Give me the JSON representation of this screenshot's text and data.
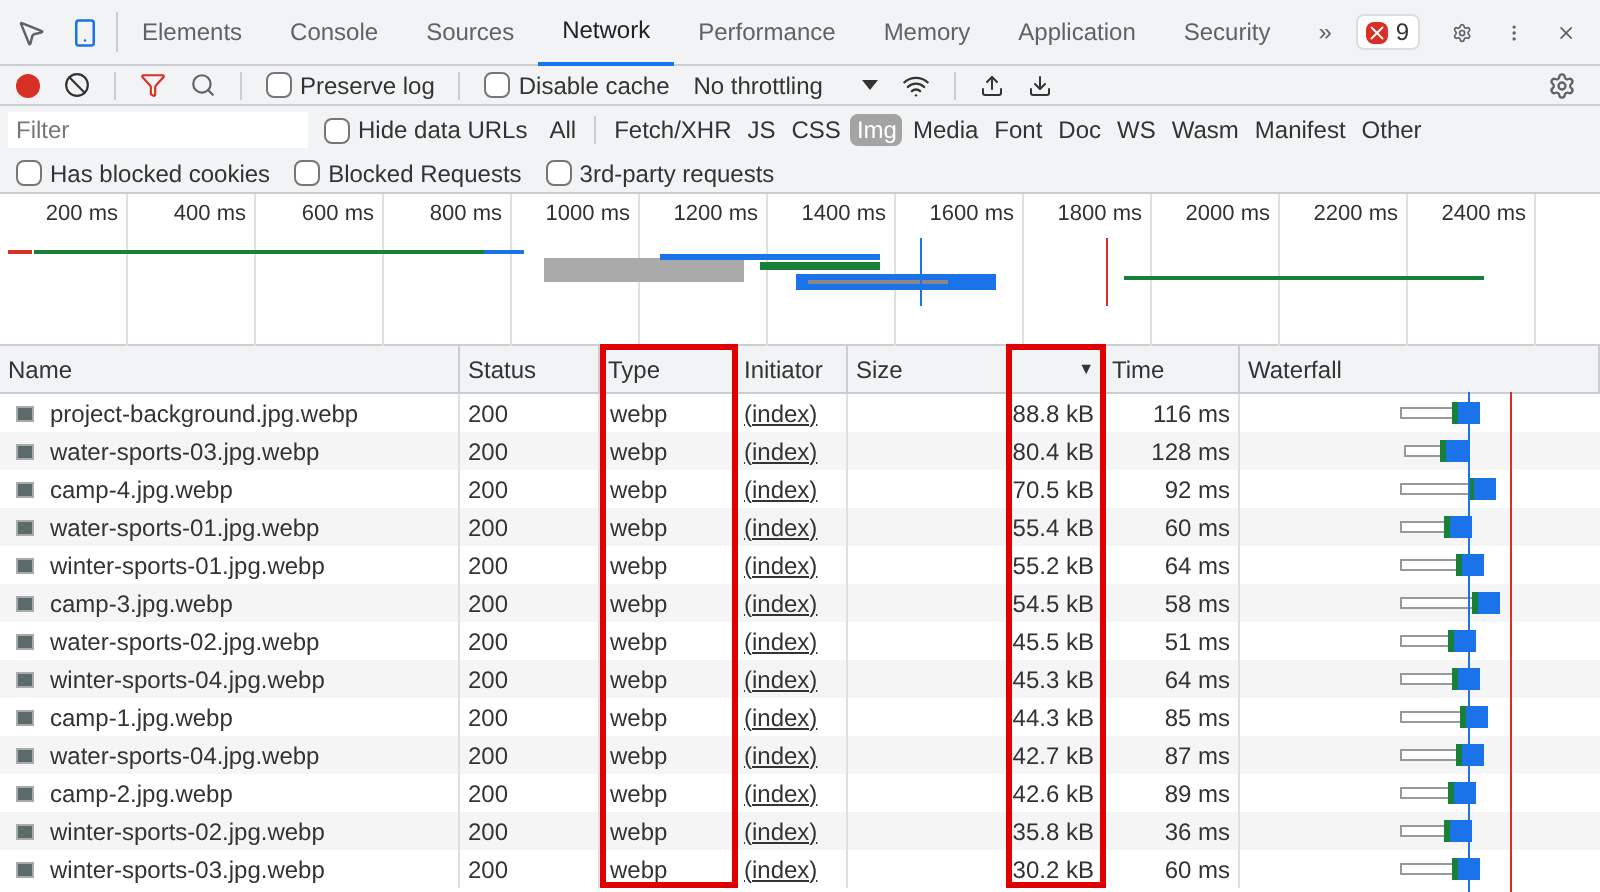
{
  "tabs": [
    {
      "label": "Elements",
      "selected": false
    },
    {
      "label": "Console",
      "selected": false
    },
    {
      "label": "Sources",
      "selected": false
    },
    {
      "label": "Network",
      "selected": true
    },
    {
      "label": "Performance",
      "selected": false
    },
    {
      "label": "Memory",
      "selected": false
    },
    {
      "label": "Application",
      "selected": false
    },
    {
      "label": "Security",
      "selected": false
    }
  ],
  "more_tabs": "»",
  "issues_badge": "9",
  "toolbar": {
    "recording": true,
    "preserve_log": {
      "label": "Preserve log",
      "checked": false
    },
    "disable_cache": {
      "label": "Disable cache",
      "checked": false
    },
    "throttling": "No throttling"
  },
  "filter": {
    "placeholder": "Filter",
    "hide_data_urls": {
      "label": "Hide data URLs",
      "checked": false
    },
    "types": [
      {
        "label": "All",
        "selected": false
      },
      {
        "label": "Fetch/XHR",
        "selected": false
      },
      {
        "label": "JS",
        "selected": false
      },
      {
        "label": "CSS",
        "selected": false
      },
      {
        "label": "Img",
        "selected": true
      },
      {
        "label": "Media",
        "selected": false
      },
      {
        "label": "Font",
        "selected": false
      },
      {
        "label": "Doc",
        "selected": false
      },
      {
        "label": "WS",
        "selected": false
      },
      {
        "label": "Wasm",
        "selected": false
      },
      {
        "label": "Manifest",
        "selected": false
      },
      {
        "label": "Other",
        "selected": false
      }
    ]
  },
  "blocked_filters": [
    {
      "label": "Has blocked cookies",
      "checked": false
    },
    {
      "label": "Blocked Requests",
      "checked": false
    },
    {
      "label": "3rd-party requests",
      "checked": false
    }
  ],
  "overview": {
    "ticks": [
      "200 ms",
      "400 ms",
      "600 ms",
      "800 ms",
      "1000 ms",
      "1200 ms",
      "1400 ms",
      "1600 ms",
      "1800 ms",
      "2000 ms",
      "2200 ms",
      "2400 ms"
    ]
  },
  "table": {
    "columns": [
      "Name",
      "Status",
      "Type",
      "Initiator",
      "Size",
      "Time",
      "Waterfall"
    ],
    "sort_indicator": "▼",
    "rows": [
      {
        "name": "project-background.jpg.webp",
        "status": "200",
        "type": "webp",
        "initiator": "(index)",
        "size": "88.8 kB",
        "time": "116 ms"
      },
      {
        "name": "water-sports-03.jpg.webp",
        "status": "200",
        "type": "webp",
        "initiator": "(index)",
        "size": "80.4 kB",
        "time": "128 ms"
      },
      {
        "name": "camp-4.jpg.webp",
        "status": "200",
        "type": "webp",
        "initiator": "(index)",
        "size": "70.5 kB",
        "time": "92 ms"
      },
      {
        "name": "water-sports-01.jpg.webp",
        "status": "200",
        "type": "webp",
        "initiator": "(index)",
        "size": "55.4 kB",
        "time": "60 ms"
      },
      {
        "name": "winter-sports-01.jpg.webp",
        "status": "200",
        "type": "webp",
        "initiator": "(index)",
        "size": "55.2 kB",
        "time": "64 ms"
      },
      {
        "name": "camp-3.jpg.webp",
        "status": "200",
        "type": "webp",
        "initiator": "(index)",
        "size": "54.5 kB",
        "time": "58 ms"
      },
      {
        "name": "water-sports-02.jpg.webp",
        "status": "200",
        "type": "webp",
        "initiator": "(index)",
        "size": "45.5 kB",
        "time": "51 ms"
      },
      {
        "name": "winter-sports-04.jpg.webp",
        "status": "200",
        "type": "webp",
        "initiator": "(index)",
        "size": "45.3 kB",
        "time": "64 ms"
      },
      {
        "name": "camp-1.jpg.webp",
        "status": "200",
        "type": "webp",
        "initiator": "(index)",
        "size": "44.3 kB",
        "time": "85 ms"
      },
      {
        "name": "water-sports-04.jpg.webp",
        "status": "200",
        "type": "webp",
        "initiator": "(index)",
        "size": "42.7 kB",
        "time": "87 ms"
      },
      {
        "name": "camp-2.jpg.webp",
        "status": "200",
        "type": "webp",
        "initiator": "(index)",
        "size": "42.6 kB",
        "time": "89 ms"
      },
      {
        "name": "winter-sports-02.jpg.webp",
        "status": "200",
        "type": "webp",
        "initiator": "(index)",
        "size": "35.8 kB",
        "time": "36 ms"
      },
      {
        "name": "winter-sports-03.jpg.webp",
        "status": "200",
        "type": "webp",
        "initiator": "(index)",
        "size": "30.2 kB",
        "time": "60 ms"
      }
    ]
  }
}
